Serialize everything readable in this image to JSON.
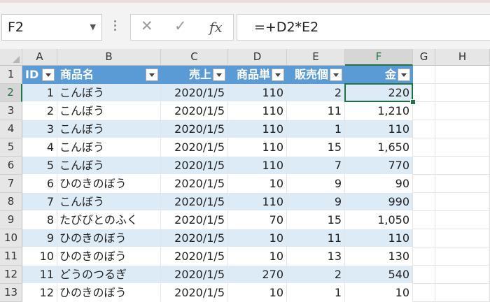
{
  "name_box": "F2",
  "formula": "=+D2*E2",
  "fx_label": "fx",
  "cancel_glyph": "✕",
  "enter_glyph": "✓",
  "column_headers": [
    "A",
    "B",
    "C",
    "D",
    "E",
    "F",
    "G",
    "H"
  ],
  "table_headers": [
    "ID",
    "商品名",
    "売上",
    "商品単",
    "販売個",
    "金"
  ],
  "row_numbers": [
    "1",
    "2",
    "3",
    "4",
    "5",
    "6",
    "7",
    "8",
    "9",
    "10",
    "11",
    "12",
    "13"
  ],
  "rows": [
    [
      "1",
      "こんぼう",
      "2020/1/5",
      "110",
      "2",
      "220"
    ],
    [
      "2",
      "こんぼう",
      "2020/1/5",
      "110",
      "11",
      "1,210"
    ],
    [
      "3",
      "こんぼう",
      "2020/1/5",
      "110",
      "1",
      "110"
    ],
    [
      "4",
      "こんぼう",
      "2020/1/5",
      "110",
      "15",
      "1,650"
    ],
    [
      "5",
      "こんぼう",
      "2020/1/5",
      "110",
      "7",
      "770"
    ],
    [
      "6",
      "ひのきのぼう",
      "2020/1/5",
      "10",
      "9",
      "90"
    ],
    [
      "7",
      "こんぼう",
      "2020/1/5",
      "110",
      "9",
      "990"
    ],
    [
      "8",
      "たびびとのふく",
      "2020/1/5",
      "70",
      "15",
      "1,050"
    ],
    [
      "9",
      "ひのきのぼう",
      "2020/1/5",
      "10",
      "11",
      "110"
    ],
    [
      "10",
      "ひのきのぼう",
      "2020/1/5",
      "10",
      "13",
      "130"
    ],
    [
      "11",
      "どうのつるぎ",
      "2020/1/5",
      "270",
      "2",
      "540"
    ],
    [
      "12",
      "ひのきのぼう",
      "2020/1/5",
      "10",
      "1",
      "10"
    ]
  ],
  "active_cell": "F2"
}
